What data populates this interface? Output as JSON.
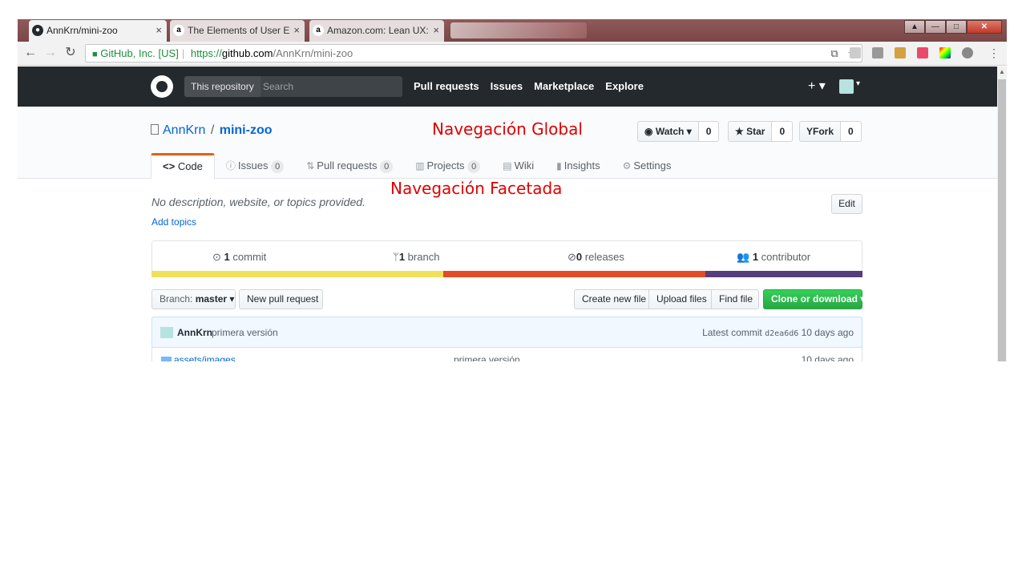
{
  "browser": {
    "tabs": [
      {
        "label": "AnnKrn/mini-zoo",
        "icon": "github-icon"
      },
      {
        "label": "The Elements of User Exp",
        "icon": "amazon-icon"
      },
      {
        "label": "Amazon.com: Lean UX: D",
        "icon": "amazon-icon"
      }
    ],
    "close_glyph": "×",
    "security_label": "GitHub, Inc. [US]",
    "url_scheme": "https://",
    "url_host": "github.com",
    "url_path": "/AnnKrn/mini-zoo"
  },
  "github": {
    "scope_label": "This repository",
    "search_placeholder": "Search",
    "nav": [
      "Pull requests",
      "Issues",
      "Marketplace",
      "Explore"
    ],
    "plus_label": "+ ▾"
  },
  "repo": {
    "owner": "AnnKrn",
    "separator": "/",
    "name": "mini-zoo",
    "actions": {
      "watch": {
        "label": "Watch ▾",
        "count": "0"
      },
      "star": {
        "label": "Star",
        "count": "0"
      },
      "fork": {
        "label": "Fork",
        "count": "0"
      }
    },
    "tabs": [
      {
        "label": "Code",
        "icon": "<>",
        "counter": ""
      },
      {
        "label": "Issues",
        "icon": "ⓘ",
        "counter": "0"
      },
      {
        "label": "Pull requests",
        "icon": "⇅",
        "counter": "0"
      },
      {
        "label": "Projects",
        "icon": "▥",
        "counter": "0"
      },
      {
        "label": "Wiki",
        "icon": "▤",
        "counter": ""
      },
      {
        "label": "Insights",
        "icon": "▮",
        "counter": ""
      },
      {
        "label": "Settings",
        "icon": "⚙",
        "counter": ""
      }
    ],
    "description": "No description, website, or topics provided.",
    "add_topics": "Add topics",
    "edit_label": "Edit",
    "summary": {
      "commits": {
        "count": "1",
        "label": "commit"
      },
      "branches": {
        "count": "1",
        "label": "branch"
      },
      "releases": {
        "count": "0",
        "label": "releases"
      },
      "contributors": {
        "count": "1",
        "label": "contributor"
      }
    },
    "language_bar_colors": [
      "#f1e05a",
      "#e34c26",
      "#563d7c"
    ],
    "branch_prefix": "Branch:",
    "branch_name": "master",
    "new_pull_request": "New pull request",
    "create_new_file": "Create new file",
    "upload_files": "Upload files",
    "find_file": "Find file",
    "clone_download": "Clone or download ▾",
    "latest_commit": {
      "author": "AnnKrn",
      "message": "primera versión",
      "prefix": "Latest commit",
      "sha": "d2ea6d6",
      "age": "10 days ago"
    },
    "files": [
      {
        "dir": "assets/",
        "name": "images",
        "message": "primera versión",
        "age": "10 days ago"
      }
    ]
  },
  "annotations": {
    "global": "Navegación Global",
    "faceted": "Navegación Facetada"
  }
}
